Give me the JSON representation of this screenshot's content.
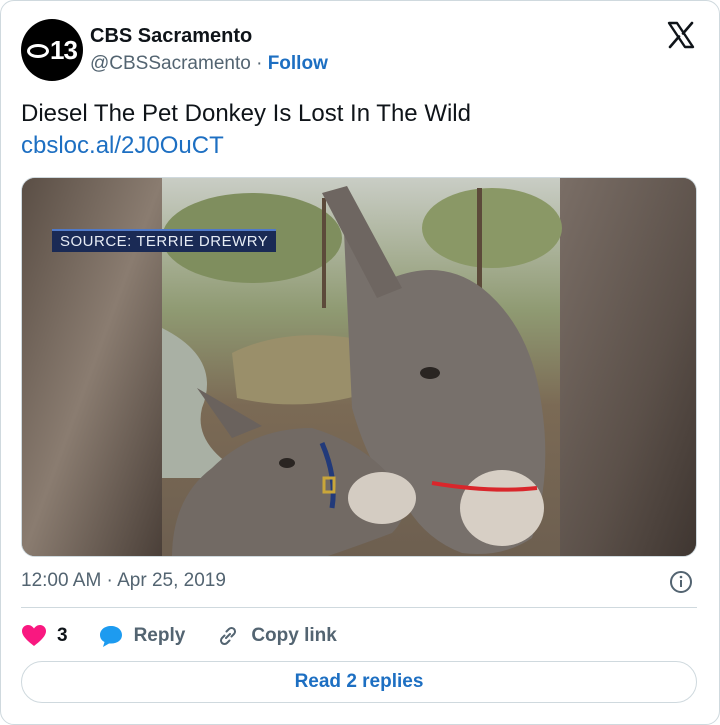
{
  "account": {
    "avatar_text": "13",
    "name": "CBS Sacramento",
    "handle": "@CBSSacramento",
    "separator": " · ",
    "follow_label": "Follow"
  },
  "tweet": {
    "text": "Diesel The Pet Donkey Is Lost In The Wild",
    "link": "cbsloc.al/2J0OuCT",
    "timestamp": "12:00 AM · Apr 25, 2019"
  },
  "media": {
    "source_label": "SOURCE: TERRIE DREWRY"
  },
  "actions": {
    "like_count": "3",
    "reply_label": "Reply",
    "copy_link_label": "Copy link"
  },
  "footer": {
    "read_replies_label": "Read 2 replies"
  },
  "colors": {
    "accent": "#1d6fc2",
    "like": "#f91880",
    "text": "#0f1419",
    "muted": "#536471",
    "border": "#cfd9de"
  },
  "icons": [
    "x-logo-icon",
    "info-icon",
    "heart-icon",
    "reply-bubble-icon",
    "link-icon"
  ]
}
